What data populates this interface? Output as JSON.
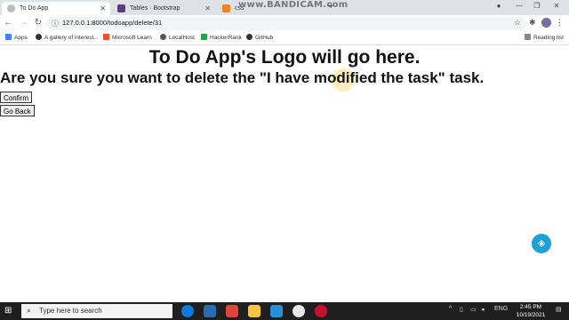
{
  "browser": {
    "tabs": [
      {
        "title": "To Do App",
        "active": true
      },
      {
        "title": "Tables · Bootstrap",
        "active": false
      },
      {
        "title": "css",
        "active": false
      }
    ],
    "watermark": "www.BANDICAM.com",
    "url": "127.0.0.1:8000/todoapp/delete/31",
    "reading_list": "Reading list",
    "bookmarks": [
      {
        "label": "Apps",
        "color": "#4285f4"
      },
      {
        "label": "A gallery of interest...",
        "color": "#333333"
      },
      {
        "label": "Microsoft Learn",
        "color": "#f25022"
      },
      {
        "label": "LocalHost",
        "color": "#555555"
      },
      {
        "label": "HackerRank",
        "color": "#1ba94c"
      },
      {
        "label": "GitHub",
        "color": "#333333"
      }
    ]
  },
  "page": {
    "logo_text": "To Do App's Logo will go here.",
    "question": "Are you sure you want to delete the \"I have modified the task\" task.",
    "confirm_label": "Confirm",
    "back_label": "Go Back"
  },
  "taskbar": {
    "search_placeholder": "Type here to search",
    "language": "ENG",
    "time": "2:45 PM",
    "date": "10/19/2021"
  },
  "colors": {
    "fab": "#1aa1d8",
    "taskbar": "#1f1f1f"
  }
}
